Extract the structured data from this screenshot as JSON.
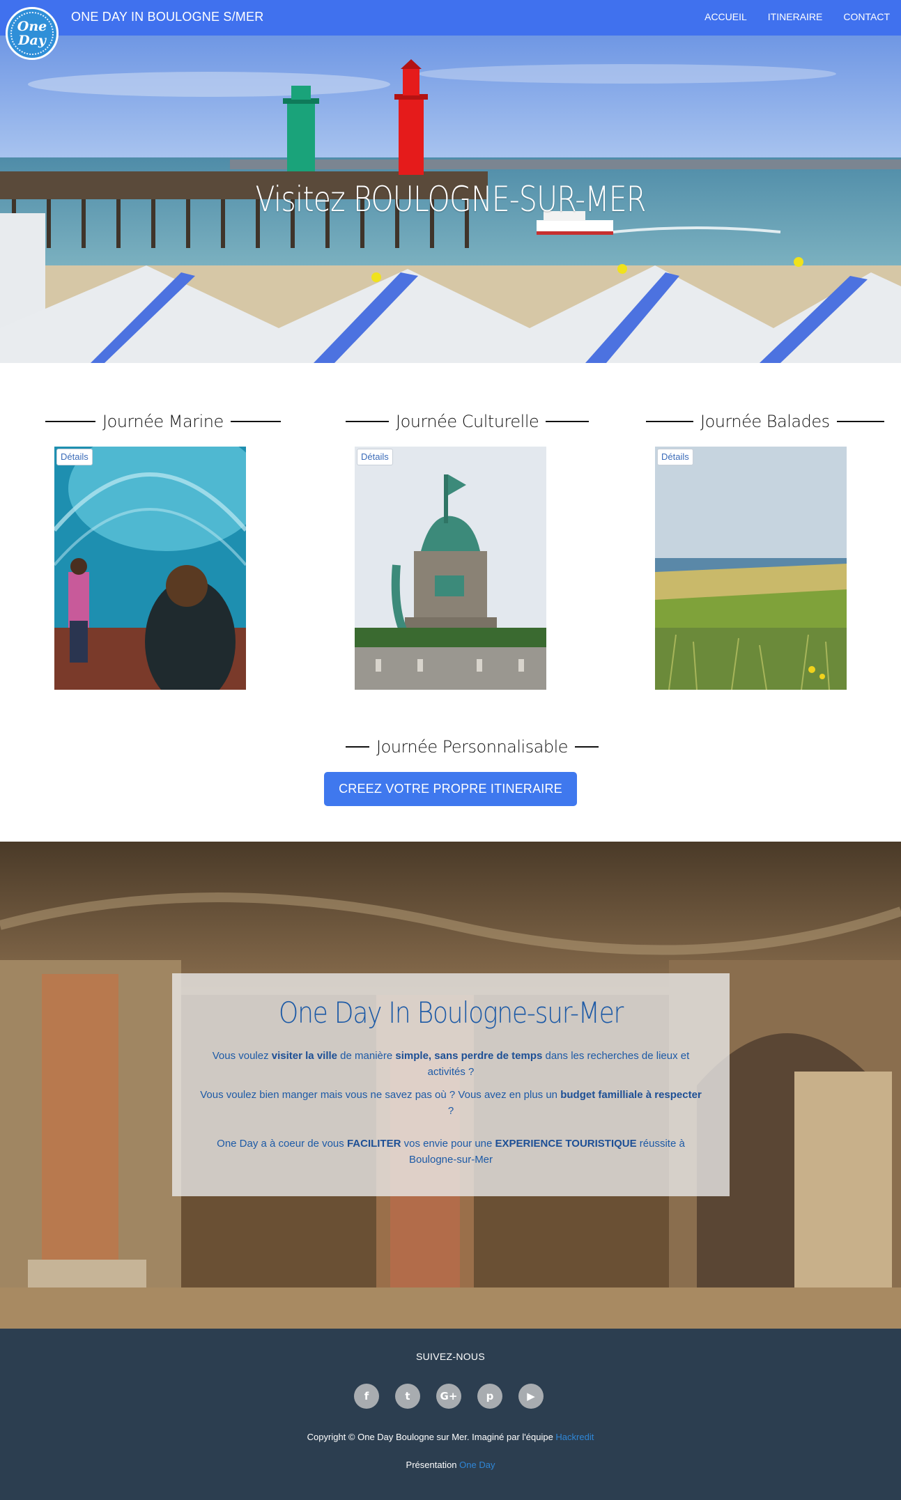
{
  "navbar": {
    "logo_top": "One",
    "logo_bottom": "Day",
    "brand": "ONE DAY IN BOULOGNE S/MER",
    "links": [
      "ACCUEIL",
      "ITINERAIRE",
      "CONTACT"
    ]
  },
  "hero": {
    "title": "Visitez BOULOGNE-SUR-MER"
  },
  "days": [
    {
      "title": "Journée Marine",
      "button": "Détails"
    },
    {
      "title": "Journée Culturelle",
      "button": "Détails"
    },
    {
      "title": "Journée Balades",
      "button": "Détails"
    }
  ],
  "custom": {
    "title": "Journée Personnalisable",
    "cta": "CREEZ VOTRE PROPRE ITINERAIRE"
  },
  "about": {
    "title": "One Day In Boulogne-sur-Mer",
    "p1_a": "Vous voulez ",
    "p1_b": "visiter la ville",
    "p1_c": " de manière ",
    "p1_d": "simple, sans perdre de temps",
    "p1_e": " dans les recherches de lieux et activités ?",
    "p2_a": "Vous voulez bien manger mais vous ne savez pas où ? Vous avez en plus un ",
    "p2_b": "budget familliale à respecter",
    "p2_c": " ?",
    "p3_a": "One Day a à coeur de vous ",
    "p3_b": "FACILITER",
    "p3_c": " vos envie pour une ",
    "p3_d": "EXPERIENCE TOURISTIQUE",
    "p3_e": " réussite à Boulogne-sur-Mer"
  },
  "footer": {
    "follow": "SUIVEZ-NOUS",
    "socials": [
      {
        "icon": "facebook-icon",
        "glyph": "f"
      },
      {
        "icon": "twitter-icon",
        "glyph": "t"
      },
      {
        "icon": "google-plus-icon",
        "glyph": "G+"
      },
      {
        "icon": "pinterest-icon",
        "glyph": "p"
      },
      {
        "icon": "youtube-icon",
        "glyph": "▶"
      }
    ],
    "copyright_text": "Copyright © One Day Boulogne sur Mer. Imaginé par l'équipe ",
    "copyright_link": "Hackredit",
    "presentation_text": "Présentation ",
    "presentation_link": "One Day"
  },
  "colors": {
    "navbar": "#4071ee",
    "cta": "#3f78ee",
    "footer": "#2c3e50",
    "about_text": "#1d5aa6"
  }
}
